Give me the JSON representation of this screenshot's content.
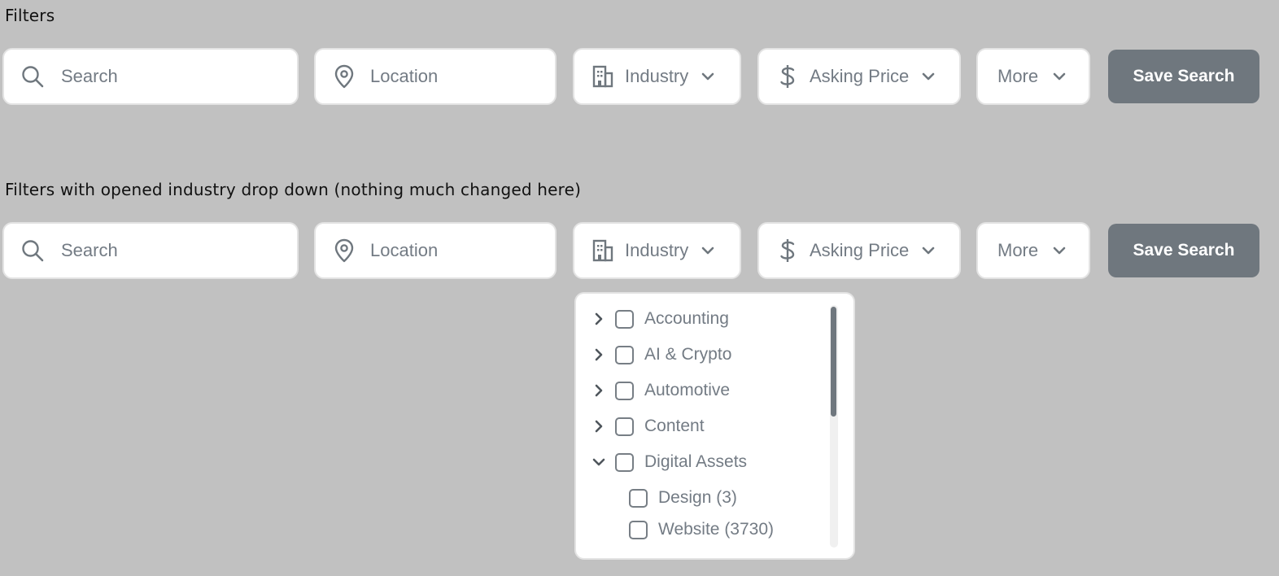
{
  "sections": [
    {
      "title": "Filters"
    },
    {
      "title": "Filters with opened industry drop down (nothing much changed here)"
    }
  ],
  "filters": {
    "search_placeholder": "Search",
    "location_placeholder": "Location",
    "industry_label": "Industry",
    "asking_price_label": "Asking Price",
    "more_label": "More",
    "save_search_label": "Save Search"
  },
  "industry_dropdown": {
    "items": [
      {
        "label": "Accounting",
        "expanded": false,
        "checked": false
      },
      {
        "label": "AI & Crypto",
        "expanded": false,
        "checked": false
      },
      {
        "label": "Automotive",
        "expanded": false,
        "checked": false
      },
      {
        "label": "Content",
        "expanded": false,
        "checked": false
      },
      {
        "label": "Digital Assets",
        "expanded": true,
        "checked": false,
        "children": [
          {
            "label": "Design (3)",
            "checked": false
          },
          {
            "label": "Website (3730)",
            "checked": false
          }
        ]
      }
    ]
  },
  "colors": {
    "background": "#c1c1c1",
    "field_bg": "#ffffff",
    "field_border": "#e3e3e3",
    "text_muted": "#737b84",
    "button_bg": "#6f777e",
    "button_text": "#ffffff"
  },
  "icons": {
    "search": "search-icon",
    "location": "map-pin-icon",
    "industry": "building-icon",
    "price": "dollar-icon",
    "dropdown": "chevron-down-icon",
    "collapsed": "chevron-right-icon"
  }
}
